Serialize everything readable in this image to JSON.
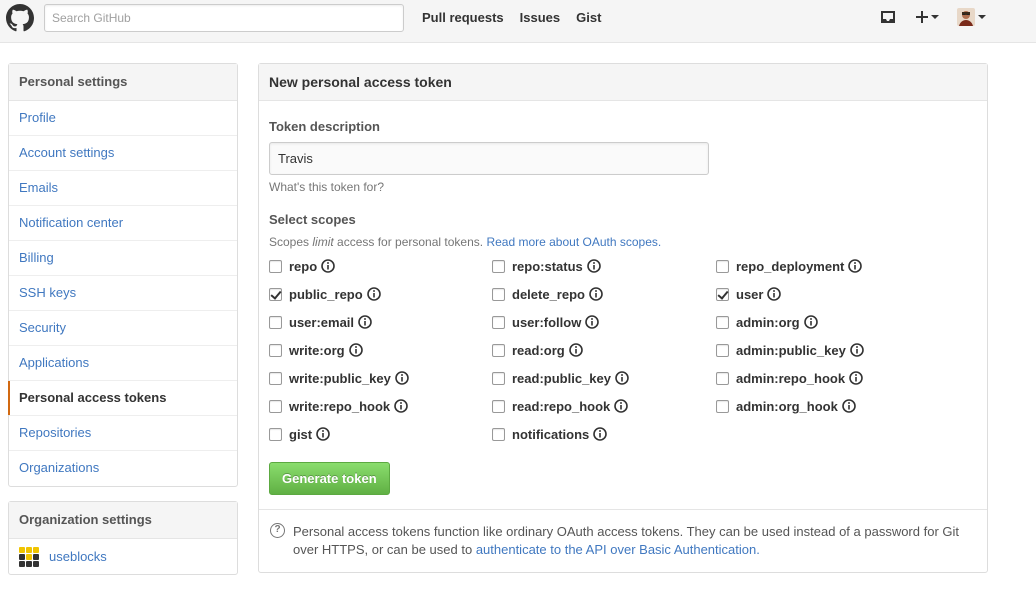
{
  "header": {
    "search_placeholder": "Search GitHub",
    "nav": [
      "Pull requests",
      "Issues",
      "Gist"
    ]
  },
  "sidebar": {
    "heading": "Personal settings",
    "items": [
      {
        "label": "Profile"
      },
      {
        "label": "Account settings"
      },
      {
        "label": "Emails"
      },
      {
        "label": "Notification center"
      },
      {
        "label": "Billing"
      },
      {
        "label": "SSH keys"
      },
      {
        "label": "Security"
      },
      {
        "label": "Applications"
      },
      {
        "label": "Personal access tokens",
        "selected": true
      },
      {
        "label": "Repositories"
      },
      {
        "label": "Organizations"
      }
    ]
  },
  "org": {
    "heading": "Organization settings",
    "name": "useblocks"
  },
  "main": {
    "title": "New personal access token",
    "token_label": "Token description",
    "token_value": "Travis",
    "token_note": "What's this token for?",
    "scopes_heading": "Select scopes",
    "scopes_desc_before": "Scopes ",
    "scopes_desc_em": "limit",
    "scopes_desc_after": " access for personal tokens. ",
    "scopes_link": "Read more about OAuth scopes.",
    "scopes": [
      [
        "repo",
        "public_repo",
        "user:email",
        "write:org",
        "write:public_key",
        "write:repo_hook",
        "gist"
      ],
      [
        "repo:status",
        "delete_repo",
        "user:follow",
        "read:org",
        "read:public_key",
        "read:repo_hook",
        "notifications"
      ],
      [
        "repo_deployment",
        "user",
        "admin:org",
        "admin:public_key",
        "admin:repo_hook",
        "admin:org_hook"
      ]
    ],
    "checked": [
      "public_repo",
      "user"
    ],
    "button": "Generate token",
    "footer_text": "Personal access tokens function like ordinary OAuth access tokens. They can be used instead of a password for Git over HTTPS, or can be used to ",
    "footer_link": "authenticate to the API over Basic Authentication."
  }
}
